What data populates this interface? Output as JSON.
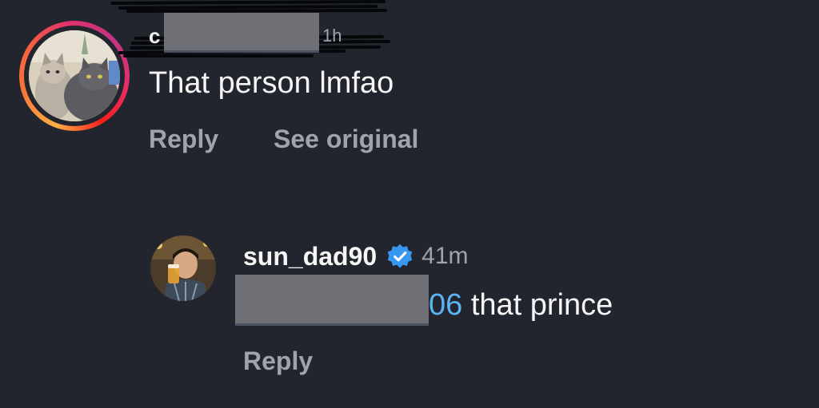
{
  "comment": {
    "username_fragment": "c",
    "time_fragment": "1h",
    "text": "That person lmfao",
    "actions": {
      "reply": "Reply",
      "see_original": "See original"
    }
  },
  "reply": {
    "username": "sun_dad90",
    "verified_icon": "verified-badge-icon",
    "time": "41m",
    "mention_visible_tail": "06",
    "text": " that prince",
    "actions": {
      "reply": "Reply"
    }
  },
  "colors": {
    "background": "#22252d",
    "text_primary": "#f5f5f5",
    "text_secondary": "#9ea3ad",
    "mention": "#5ab5f5",
    "verified_badge": "#3897f0",
    "redaction": "#6f7075"
  }
}
